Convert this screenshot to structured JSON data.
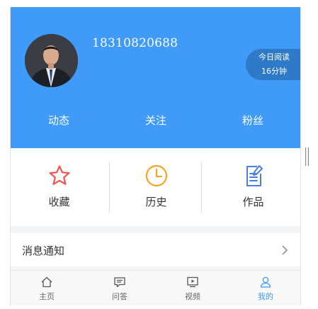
{
  "profile": {
    "phone": "18310820688",
    "reading_label": "今日阅读",
    "reading_value": "16分钟"
  },
  "stats": [
    {
      "label": "动态"
    },
    {
      "label": "关注"
    },
    {
      "label": "粉丝"
    }
  ],
  "quick_actions": [
    {
      "label": "收藏",
      "icon": "star-icon",
      "color": "#f05353"
    },
    {
      "label": "历史",
      "icon": "clock-icon",
      "color": "#f5a623"
    },
    {
      "label": "作品",
      "icon": "document-edit-icon",
      "color": "#4a7fe0"
    }
  ],
  "menu": {
    "notifications_label": "消息通知",
    "chevron_icon": "chevron-right-icon"
  },
  "tabbar": {
    "items": [
      {
        "label": "主页",
        "icon": "home-icon"
      },
      {
        "label": "问答",
        "icon": "message-icon"
      },
      {
        "label": "视频",
        "icon": "video-icon"
      },
      {
        "label": "我的",
        "icon": "user-icon"
      }
    ],
    "active_index": 3,
    "active_color": "#3f9bf7"
  },
  "theme": {
    "header_color": "#3f9bf7",
    "reading_badge_color": "#2f79c9"
  }
}
